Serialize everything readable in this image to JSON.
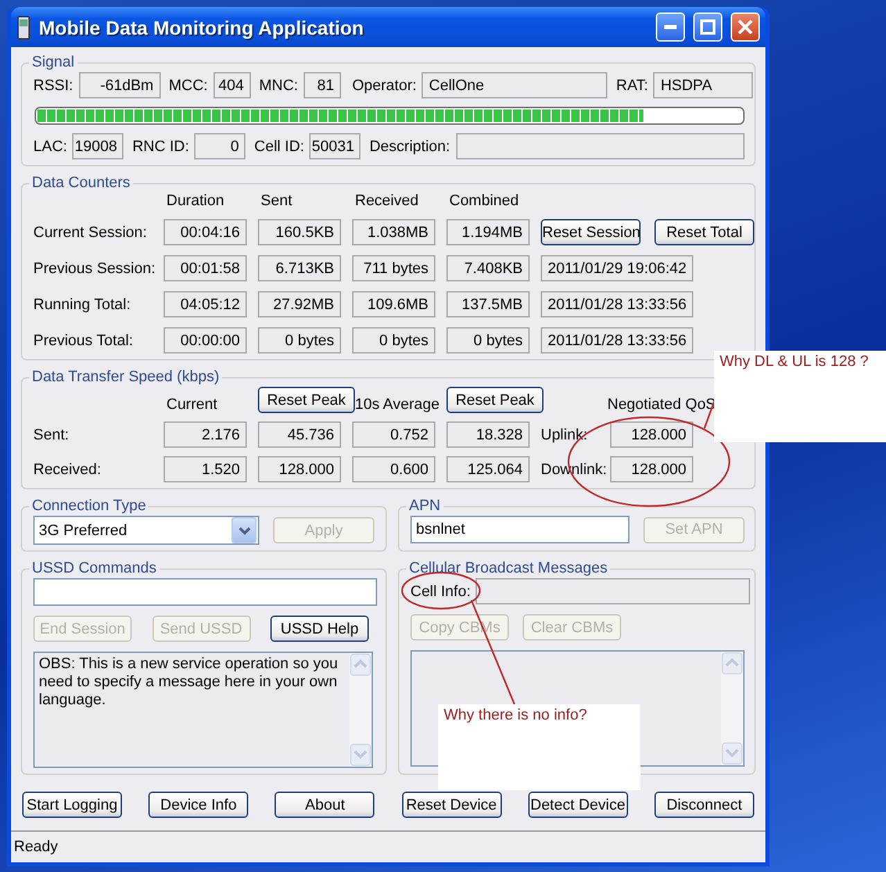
{
  "window": {
    "title": "Mobile Data Monitoring Application"
  },
  "signal": {
    "title": "Signal",
    "level": 0.86,
    "row_1": [
      {
        "label": "RSSI:",
        "value": "-61dBm"
      },
      {
        "label": "MCC:",
        "value": "404"
      },
      {
        "label": "MNC:",
        "value": "81"
      },
      {
        "label": "Operator:",
        "value": "CellOne"
      },
      {
        "label": "RAT:",
        "value": "HSDPA"
      }
    ],
    "row_2": [
      {
        "label": "LAC:",
        "value": "19008"
      },
      {
        "label": "RNC ID:",
        "value": "0"
      },
      {
        "label": "Cell ID:",
        "value": "50031"
      },
      {
        "label": "Description:"
      }
    ]
  },
  "data_counters": {
    "title": "Data Counters",
    "columns": [
      "Duration",
      "Sent",
      "Received",
      "Combined"
    ],
    "rows": [
      {
        "label": "Current Session:",
        "values": [
          "00:04:16",
          "160.5KB",
          "1.038MB",
          "1.194MB"
        ],
        "kind": "buttons",
        "buttons": [
          "Reset Session",
          "Reset Total"
        ]
      },
      {
        "label": "Previous Session:",
        "values": [
          "00:01:58",
          "6.713KB",
          "711 bytes",
          "7.408KB"
        ],
        "kind": "timestamp",
        "timestamp": "2011/01/29 19:06:42"
      },
      {
        "label": "Running Total:",
        "values": [
          "04:05:12",
          "27.92MB",
          "109.6MB",
          "137.5MB"
        ],
        "kind": "timestamp",
        "timestamp": "2011/01/28 13:33:56"
      },
      {
        "label": "Previous Total:",
        "values": [
          "00:00:00",
          "0 bytes",
          "0 bytes",
          "0 bytes"
        ],
        "kind": "timestamp",
        "timestamp": "2011/01/28 13:33:56"
      }
    ]
  },
  "data_transfer_speed": {
    "title": "Data Transfer Speed (kbps)",
    "current": "Current",
    "reset_peak_1": "Reset Peak",
    "average": "10s Average",
    "reset_peak_2": "Reset Peak",
    "qos": "Negotiated QoS",
    "rows": [
      {
        "label": "Sent:",
        "values": [
          "2.176",
          "45.736",
          "0.752",
          "18.328"
        ],
        "qos_label": "Uplink:",
        "qos_value": "128.000"
      },
      {
        "label": "Received:",
        "values": [
          "1.520",
          "128.000",
          "0.600",
          "125.064"
        ],
        "qos_label": "Downlink:",
        "qos_value": "128.000"
      }
    ]
  },
  "connection_type": {
    "title": "Connection Type",
    "value": "3G Preferred",
    "button": {
      "label": "Apply",
      "disabled": true
    }
  },
  "apn": {
    "title": "APN",
    "value": "bsnlnet",
    "button": {
      "label": "Set APN",
      "disabled": true
    }
  },
  "ussd": {
    "title": "USSD Commands",
    "buttons": [
      {
        "label": "End Session",
        "disabled": true
      },
      {
        "label": "Send USSD",
        "disabled": true
      },
      {
        "label": "USSD Help",
        "disabled": false
      }
    ],
    "message": "OBS: This is a new service operation so you need to specify a message here in your own language."
  },
  "cell_broadcast": {
    "title": "Cellular Broadcast Messages",
    "cell_info_label": "Cell Info:",
    "buttons": [
      {
        "label": "Copy CBMs",
        "disabled": true
      },
      {
        "label": "Clear CBMs",
        "disabled": true
      }
    ]
  },
  "bottom_buttons": [
    "Start Logging",
    "Device Info",
    "About",
    "Reset Device",
    "Detect Device",
    "Disconnect"
  ],
  "status_bar": "Ready",
  "annotations": [
    {
      "kind": "qos",
      "text": "Why DL & UL is 128 ?"
    },
    {
      "kind": "cell_info",
      "text": "Why there is no info?"
    }
  ]
}
